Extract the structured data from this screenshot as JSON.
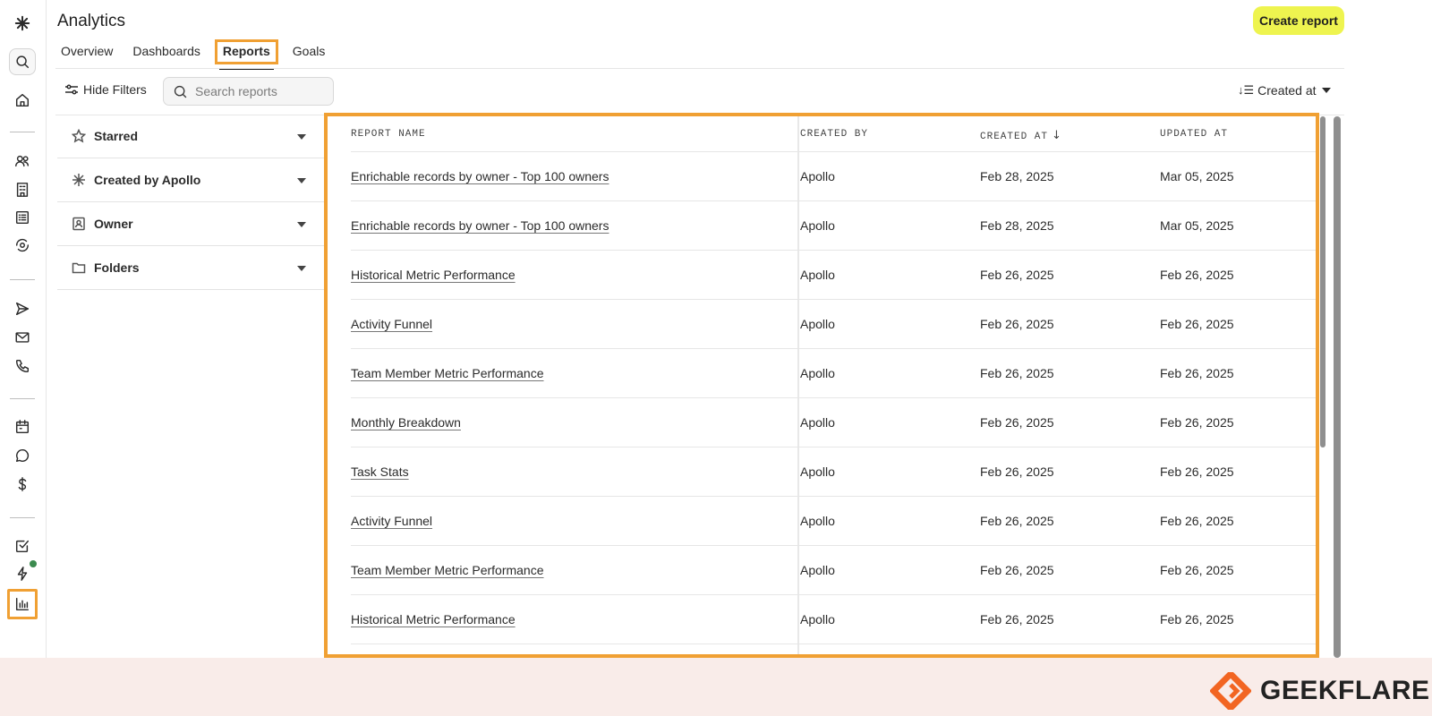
{
  "header": {
    "title": "Analytics",
    "create_label": "Create report"
  },
  "tabs": [
    {
      "label": "Overview",
      "active": false
    },
    {
      "label": "Dashboards",
      "active": false
    },
    {
      "label": "Reports",
      "active": true
    },
    {
      "label": "Goals",
      "active": false
    }
  ],
  "toolbar": {
    "hide_filters_label": "Hide Filters",
    "search_placeholder": "Search reports",
    "sort_label": "Created at"
  },
  "filters": [
    {
      "label": "Starred",
      "icon": "star-icon"
    },
    {
      "label": "Created by Apollo",
      "icon": "apollo-logo-icon"
    },
    {
      "label": "Owner",
      "icon": "person-badge-icon"
    },
    {
      "label": "Folders",
      "icon": "folder-icon"
    }
  ],
  "table": {
    "columns": [
      "REPORT NAME",
      "CREATED BY",
      "CREATED AT",
      "UPDATED AT"
    ],
    "sort_column": "CREATED AT",
    "rows": [
      {
        "name": "Enrichable records by owner - Top 100 owners",
        "created_by": "Apollo",
        "created_at": "Feb 28, 2025",
        "updated_at": "Mar 05, 2025"
      },
      {
        "name": "Enrichable records by owner - Top 100 owners",
        "created_by": "Apollo",
        "created_at": "Feb 28, 2025",
        "updated_at": "Mar 05, 2025"
      },
      {
        "name": "Historical Metric Performance",
        "created_by": "Apollo",
        "created_at": "Feb 26, 2025",
        "updated_at": "Feb 26, 2025"
      },
      {
        "name": "Activity Funnel",
        "created_by": "Apollo",
        "created_at": "Feb 26, 2025",
        "updated_at": "Feb 26, 2025"
      },
      {
        "name": "Team Member Metric Performance",
        "created_by": "Apollo",
        "created_at": "Feb 26, 2025",
        "updated_at": "Feb 26, 2025"
      },
      {
        "name": "Monthly Breakdown",
        "created_by": "Apollo",
        "created_at": "Feb 26, 2025",
        "updated_at": "Feb 26, 2025"
      },
      {
        "name": "Task Stats",
        "created_by": "Apollo",
        "created_at": "Feb 26, 2025",
        "updated_at": "Feb 26, 2025"
      },
      {
        "name": "Activity Funnel",
        "created_by": "Apollo",
        "created_at": "Feb 26, 2025",
        "updated_at": "Feb 26, 2025"
      },
      {
        "name": "Team Member Metric Performance",
        "created_by": "Apollo",
        "created_at": "Feb 26, 2025",
        "updated_at": "Feb 26, 2025"
      },
      {
        "name": "Historical Metric Performance",
        "created_by": "Apollo",
        "created_at": "Feb 26, 2025",
        "updated_at": "Feb 26, 2025"
      }
    ]
  },
  "sidebar": {
    "icons": [
      "apollo-logo-icon",
      "search-icon",
      "home-icon",
      "people-icon",
      "building-icon",
      "list-icon",
      "eye-refresh-icon",
      "send-icon",
      "mail-icon",
      "phone-icon",
      "calendar-icon",
      "chat-icon",
      "dollar-icon",
      "checkbox-icon",
      "lightning-icon",
      "analytics-icon"
    ],
    "active": "analytics-icon"
  },
  "footer": {
    "brand": "GEEKFLARE"
  },
  "colors": {
    "highlight": "#f0a033",
    "create_button": "#eef44f",
    "footer_bg": "#f9ece9",
    "brand_orange": "#f26522"
  }
}
